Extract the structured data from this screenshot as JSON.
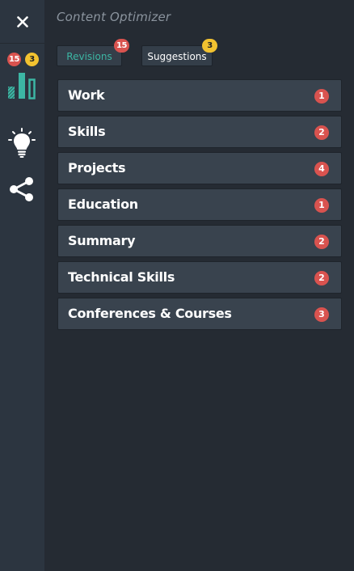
{
  "sidebar": {
    "close_icon": "close-icon",
    "optimizer": {
      "icon": "bar-chart-icon",
      "revisions_badge": "15",
      "suggestions_badge": "3"
    },
    "tips_icon": "lightbulb-icon",
    "share_icon": "share-icon"
  },
  "header": {
    "title": "Content Optimizer"
  },
  "tabs": [
    {
      "label": "Revisions",
      "badge": "15",
      "active": true
    },
    {
      "label": "Suggestions",
      "badge": "3",
      "active": false
    }
  ],
  "sections": [
    {
      "label": "Work",
      "count": "1"
    },
    {
      "label": "Skills",
      "count": "2"
    },
    {
      "label": "Projects",
      "count": "4"
    },
    {
      "label": "Education",
      "count": "1"
    },
    {
      "label": "Summary",
      "count": "2"
    },
    {
      "label": "Technical Skills",
      "count": "2"
    },
    {
      "label": "Conferences & Courses",
      "count": "3"
    }
  ],
  "colors": {
    "background": "#252b33",
    "sidebar": "#2c3540",
    "row": "#39434e",
    "accent_teal": "#3cb6a4",
    "badge_red": "#d9534f",
    "badge_yellow": "#f2c230"
  }
}
